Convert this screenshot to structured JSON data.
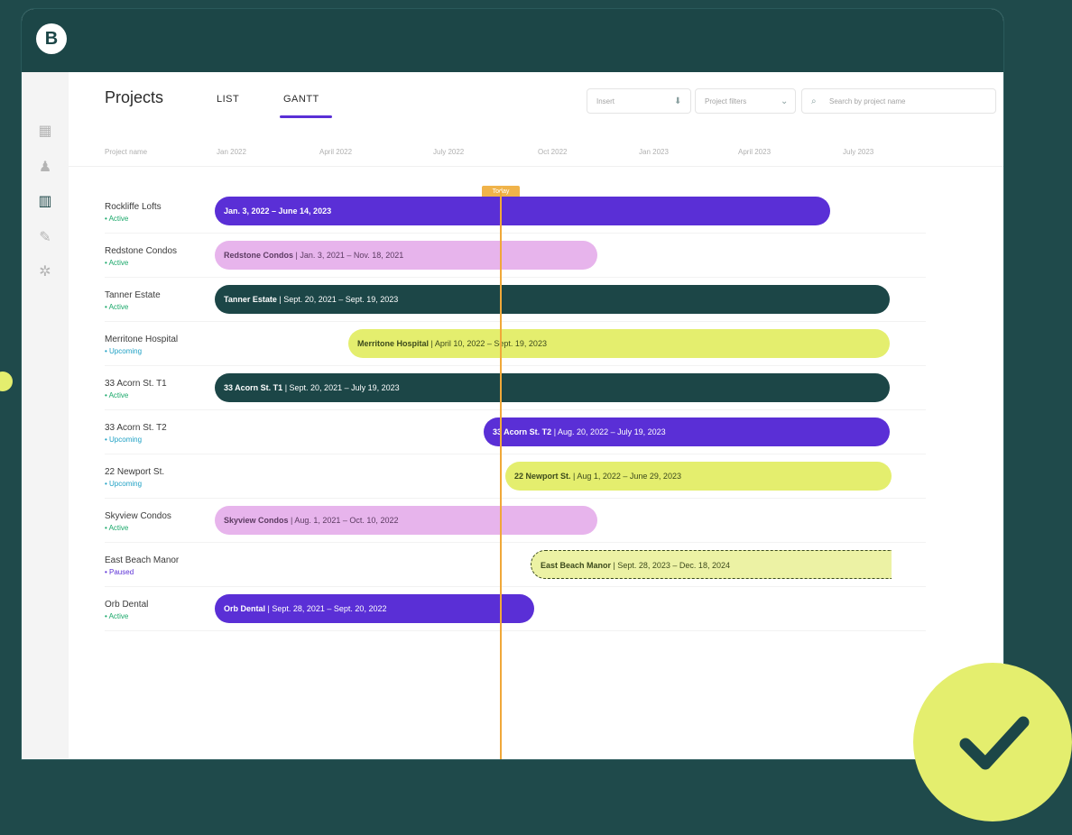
{
  "app": {
    "logo_letter": "B"
  },
  "sidebar": {
    "icons": [
      "dashboard-icon",
      "user-icon",
      "building-icon",
      "wrench-icon",
      "gear-icon"
    ],
    "active": "building-icon"
  },
  "header": {
    "title": "Projects",
    "tabs": [
      {
        "label": "LIST",
        "active": false
      },
      {
        "label": "GANTT",
        "active": true
      }
    ],
    "insert_label": "Insert",
    "filter_label": "Project filters",
    "search_placeholder": "Search by project name"
  },
  "gantt": {
    "columns": [
      "Project name",
      "Jan 2022",
      "April 2022",
      "July 2022",
      "Oct 2022",
      "Jan 2023",
      "April 2023",
      "July 2023"
    ],
    "today_label": "Today",
    "rows": [
      {
        "name": "Rockliffe Lofts",
        "status": "• Active",
        "status_type": "active",
        "bar_color": "purple",
        "bar_title": "",
        "bar_dates": "Jan. 3, 2022 – June 14, 2023"
      },
      {
        "name": "Redstone Condos",
        "status": "• Active",
        "status_type": "active",
        "bar_color": "pink",
        "bar_title": "Redstone Condos",
        "bar_dates": "Jan. 3, 2021 – Nov. 18, 2021"
      },
      {
        "name": "Tanner Estate",
        "status": "• Active",
        "status_type": "active",
        "bar_color": "teal",
        "bar_title": "Tanner Estate",
        "bar_dates": "Sept. 20, 2021 – Sept. 19, 2023"
      },
      {
        "name": "Merritone Hospital",
        "status": "• Upcoming",
        "status_type": "upcoming",
        "bar_color": "lime",
        "bar_title": "Merritone Hospital",
        "bar_dates": "April 10, 2022 – Sept. 19, 2023"
      },
      {
        "name": "33 Acorn St. T1",
        "status": "• Active",
        "status_type": "active",
        "bar_color": "teal",
        "bar_title": "33 Acorn St. T1",
        "bar_dates": "Sept. 20, 2021 – July 19, 2023"
      },
      {
        "name": "33 Acorn St. T2",
        "status": "• Upcoming",
        "status_type": "upcoming",
        "bar_color": "purple",
        "bar_title": "33 Acorn St. T2",
        "bar_dates": "Aug. 20, 2022 – July 19, 2023"
      },
      {
        "name": "22 Newport St.",
        "status": "• Upcoming",
        "status_type": "upcoming",
        "bar_color": "lime",
        "bar_title": "22 Newport St.",
        "bar_dates": "Aug 1, 2022 – June 29, 2023"
      },
      {
        "name": "Skyview Condos",
        "status": "• Active",
        "status_type": "active",
        "bar_color": "pink",
        "bar_title": "Skyview Condos",
        "bar_dates": "Aug. 1, 2021 – Oct. 10, 2022"
      },
      {
        "name": "East Beach Manor",
        "status": "• Paused",
        "status_type": "paused",
        "bar_color": "dashed",
        "bar_title": "East Beach Manor",
        "bar_dates": "Sept. 28, 2023 – Dec. 18, 2024"
      },
      {
        "name": "Orb Dental",
        "status": "• Active",
        "status_type": "active",
        "bar_color": "purple",
        "bar_title": "Orb Dental",
        "bar_dates": "Sept. 28, 2021 – Sept. 20, 2022"
      }
    ]
  },
  "colors": {
    "background": "#1f4a4b",
    "purple": "#5a2fd6",
    "pink": "#e7b4ec",
    "teal": "#1c4647",
    "lime": "#e4ee6e",
    "today": "#f0a839"
  }
}
